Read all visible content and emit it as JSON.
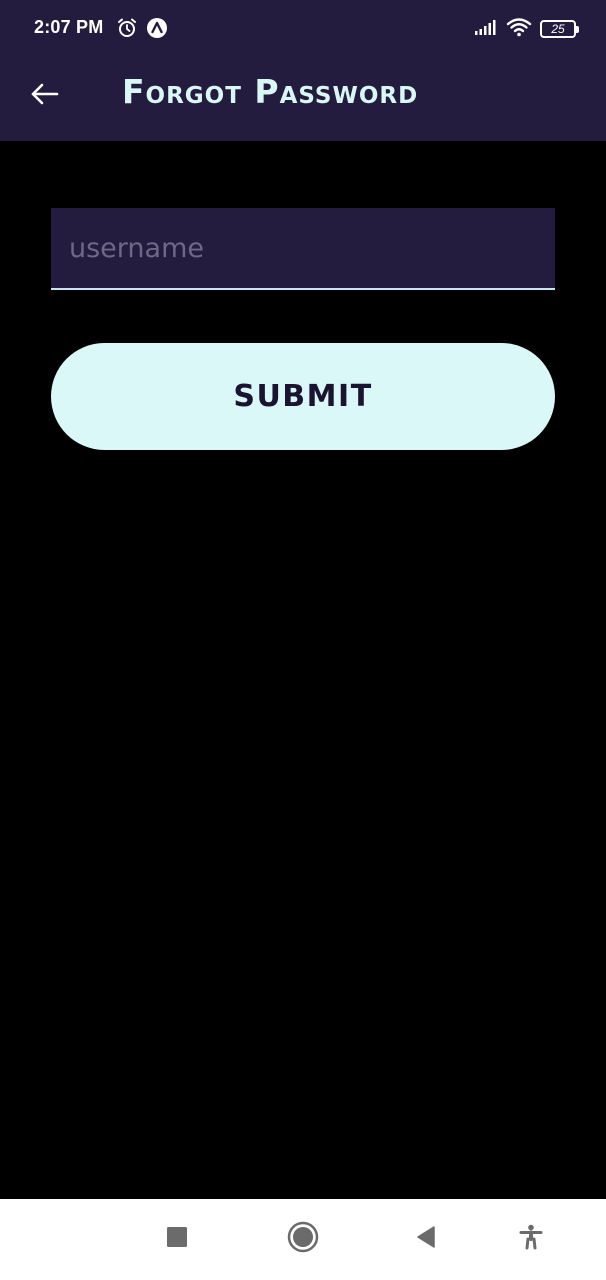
{
  "status_bar": {
    "time": "2:07 PM",
    "battery_level": "25",
    "icons": [
      "alarm-clock-icon",
      "app-notification-icon",
      "signal-icon",
      "wifi-icon",
      "battery-icon"
    ]
  },
  "app_bar": {
    "back_icon": "arrow-left-icon",
    "title": "Forgot Password"
  },
  "form": {
    "username_placeholder": "username",
    "username_value": "",
    "submit_label": "SUBMIT"
  },
  "nav_bar": {
    "icons": [
      "recent-apps-icon",
      "home-icon",
      "back-icon",
      "accessibility-icon"
    ]
  },
  "colors": {
    "app_bar_bg": "#241c3e",
    "page_bg": "#000000",
    "accent": "#d9f8f7",
    "title_text": "#d8f7f5",
    "placeholder_text": "#6e6786",
    "button_text": "#1a1430",
    "nav_bg": "#ffffff",
    "nav_icon": "#6b6b6b"
  }
}
